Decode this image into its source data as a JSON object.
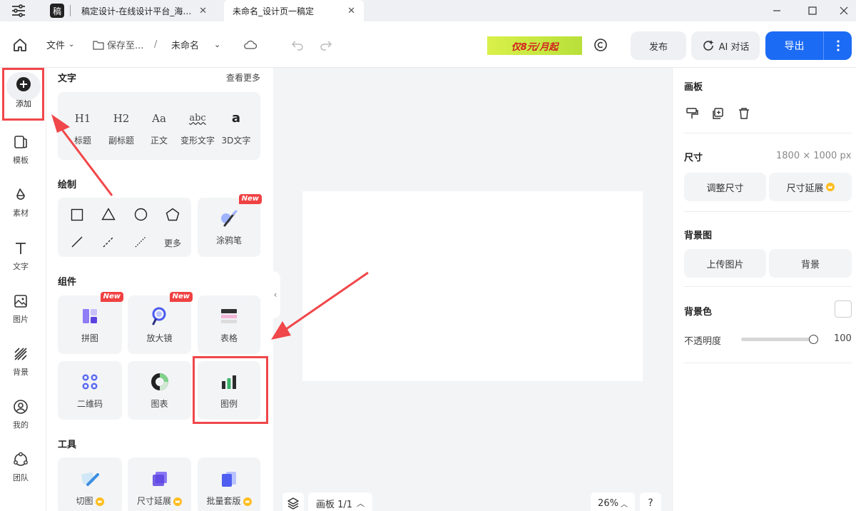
{
  "titlebar": {
    "tab1": "稿定设计-在线设计平台_海…",
    "tab2": "未命名_设计页一稿定",
    "app_logo": "稿"
  },
  "toolbar": {
    "file": "文件",
    "save": "保存至...",
    "separator": "/",
    "doc_name": "未命名",
    "promo": "仅8元/月起",
    "publish": "发布",
    "ai_chat": "AI 对话",
    "export": "导出"
  },
  "sidebar": {
    "items": [
      {
        "label": "添加",
        "icon": "plus-circle-icon"
      },
      {
        "label": "模板",
        "icon": "template-icon"
      },
      {
        "label": "素材",
        "icon": "material-icon"
      },
      {
        "label": "文字",
        "icon": "text-icon"
      },
      {
        "label": "图片",
        "icon": "image-icon"
      },
      {
        "label": "背景",
        "icon": "background-icon"
      },
      {
        "label": "我的",
        "icon": "user-icon"
      },
      {
        "label": "团队",
        "icon": "team-icon"
      }
    ]
  },
  "panel": {
    "text_section": {
      "title": "文字",
      "more": "查看更多",
      "items": [
        {
          "glyph": "H1",
          "label": "标题"
        },
        {
          "glyph": "H2",
          "label": "副标题"
        },
        {
          "glyph": "Aa",
          "label": "正文"
        },
        {
          "glyph": "abc",
          "label": "变形文字"
        },
        {
          "glyph": "a",
          "label": "3D文字"
        }
      ]
    },
    "draw_section": {
      "title": "绘制",
      "more": "更多",
      "doodle": "涂鸦笔",
      "new_badge": "New"
    },
    "component_section": {
      "title": "组件",
      "items": [
        {
          "label": "拼图",
          "new": "New"
        },
        {
          "label": "放大镜",
          "new": "New"
        },
        {
          "label": "表格"
        },
        {
          "label": "二维码"
        },
        {
          "label": "图表"
        },
        {
          "label": "图例"
        }
      ]
    },
    "tools_section": {
      "title": "工具",
      "items": [
        {
          "label": "切图"
        },
        {
          "label": "尺寸延展"
        },
        {
          "label": "批量套版"
        }
      ]
    }
  },
  "canvas": {
    "page_indicator": "画板 1/1",
    "zoom": "26%",
    "help": "?"
  },
  "right_panel": {
    "artboard_title": "画板",
    "size_title": "尺寸",
    "size_value": "1800 × 1000 px",
    "resize": "调整尺寸",
    "extend": "尺寸延展",
    "bg_image_title": "背景图",
    "upload": "上传图片",
    "background": "背景",
    "bg_color_title": "背景色",
    "opacity_label": "不透明度",
    "opacity_value": "100"
  },
  "colors": {
    "accent": "#1c6bf5",
    "highlight": "#f0474a",
    "new_badge": "#f04142"
  }
}
